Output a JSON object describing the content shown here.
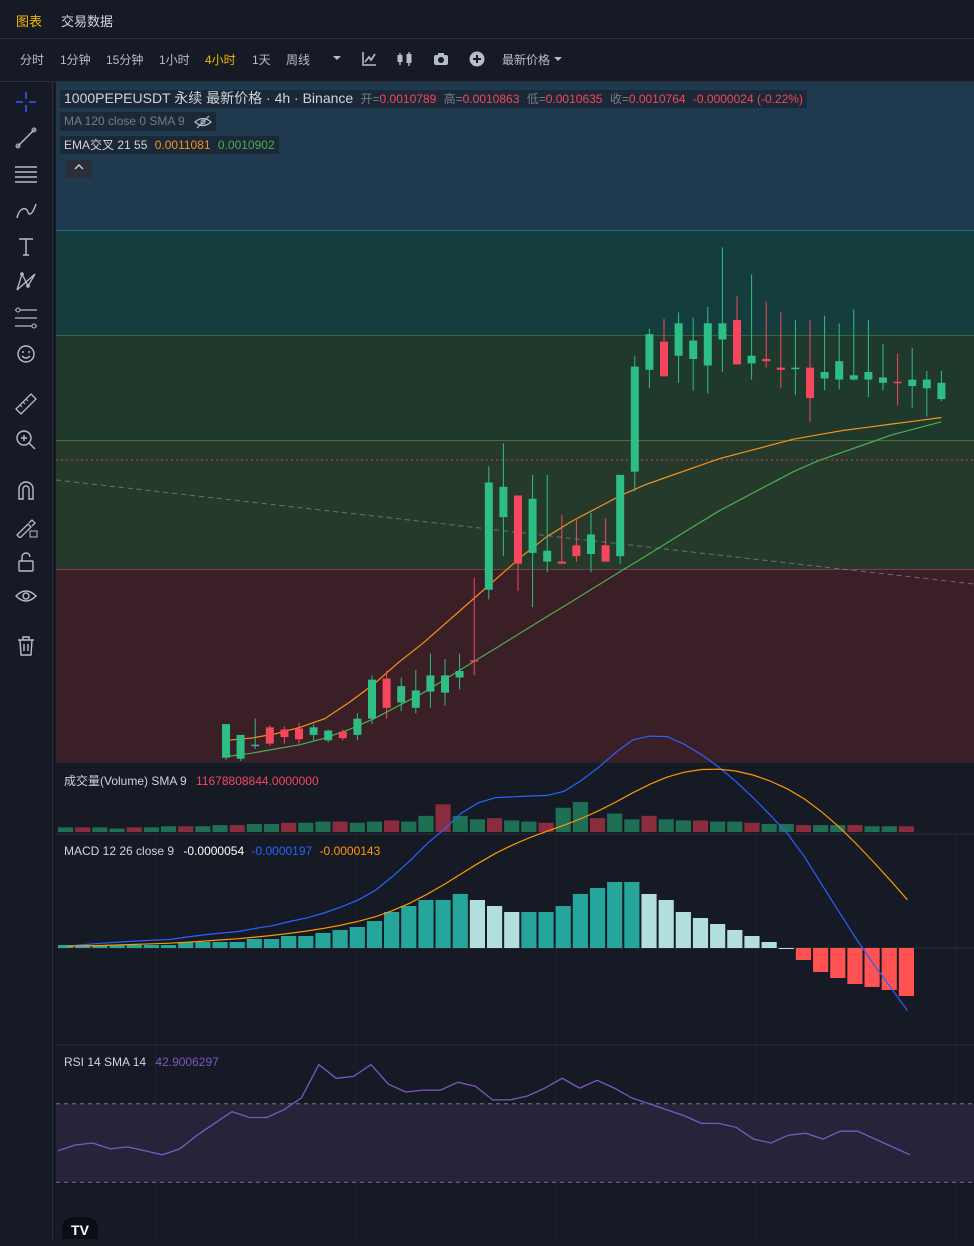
{
  "tabs": [
    {
      "label": "图表",
      "active": true
    },
    {
      "label": "交易数据",
      "active": false
    }
  ],
  "toolbar": {
    "intervals": [
      {
        "label": "分时"
      },
      {
        "label": "1分钟"
      },
      {
        "label": "15分钟"
      },
      {
        "label": "1小时"
      },
      {
        "label": "4小时",
        "active": true
      },
      {
        "label": "1天"
      },
      {
        "label": "周线"
      }
    ],
    "price_type": "最新价格",
    "icons": [
      "chevron-down-icon",
      "indicator-icon",
      "candle-type-icon",
      "camera-icon",
      "add-icon"
    ]
  },
  "sidebar_tools": [
    "crosshair-icon",
    "trend-line-icon",
    "horizontal-lines-icon",
    "brush-icon",
    "text-icon",
    "pattern-icon",
    "fib-icon",
    "emoji-icon",
    "ruler-icon",
    "zoom-icon",
    "magnet-icon",
    "lock-draw-icon",
    "unlock-icon",
    "eye-icon",
    "trash-icon"
  ],
  "legend": {
    "symbol": "1000PEPEUSDT 永续 最新价格 · 4h · Binance",
    "open_label": "开=",
    "open": "0.0010789",
    "high_label": "高=",
    "high": "0.0010863",
    "low_label": "低=",
    "low": "0.0010635",
    "close_label": "收=",
    "close": "0.0010764",
    "change": "-0.0000024 (-0.22%)",
    "ma_text": "MA 120 close 0 SMA 9",
    "ema_text": "EMA交叉 21 55",
    "ema21": "0.0011081",
    "ema55": "0.0010902"
  },
  "volume": {
    "label": "成交量(Volume) SMA 9",
    "value": "11678808844.0000000"
  },
  "macd": {
    "label": "MACD 12 26 close 9",
    "hist": "-0.0000054",
    "macd": "-0.0000197",
    "signal": "-0.0000143"
  },
  "rsi": {
    "label": "RSI 14 SMA 14",
    "value": "42.9006297"
  },
  "logo": "TV",
  "colors": {
    "up": "#2ebd85",
    "down": "#f6465d",
    "ema21": "#f7931a",
    "ema55": "#4caf50",
    "macd": "#2962ff",
    "signal": "#ff9800",
    "rsi": "#7e57c2",
    "accent": "#f0b90b"
  },
  "chart_data": [
    {
      "type": "candlestick",
      "title": "1000PEPEUSDT 永续 最新价格 4h",
      "zones": [
        {
          "color": "teal-blue"
        },
        {
          "color": "teal-green"
        },
        {
          "color": "green"
        },
        {
          "color": "dark-green"
        },
        {
          "color": "dark-red"
        }
      ],
      "candles": [
        [
          2,
          22,
          4,
          35
        ],
        [
          1,
          18,
          3,
          25
        ],
        [
          12,
          40,
          15,
          16
        ],
        [
          15,
          34,
          32,
          17
        ],
        [
          17,
          33,
          30,
          23
        ],
        [
          17,
          36,
          31,
          21
        ],
        [
          20,
          35,
          25,
          32
        ],
        [
          18,
          30,
          20,
          29
        ],
        [
          20,
          30,
          28,
          22
        ],
        [
          20,
          45,
          25,
          40
        ],
        [
          35,
          80,
          40,
          76
        ],
        [
          40,
          84,
          77,
          50
        ],
        [
          47,
          78,
          55,
          70
        ],
        [
          45,
          85,
          50,
          66
        ],
        [
          50,
          100,
          65,
          80
        ],
        [
          52,
          95,
          64,
          80
        ],
        [
          67,
          100,
          78,
          84
        ],
        [
          80,
          170,
          94,
          93
        ],
        [
          150,
          273,
          159,
          258
        ],
        [
          190,
          294,
          226,
          254
        ],
        [
          158,
          245,
          246,
          183
        ],
        [
          143,
          265,
          193,
          243
        ],
        [
          175,
          265,
          185,
          195
        ],
        [
          183,
          228,
          185,
          183
        ],
        [
          185,
          225,
          200,
          190
        ],
        [
          175,
          230,
          192,
          210
        ],
        [
          190,
          225,
          200,
          185
        ],
        [
          183,
          263,
          190,
          265
        ],
        [
          250,
          375,
          268,
          365
        ],
        [
          345,
          400,
          362,
          395
        ],
        [
          356,
          409,
          388,
          356
        ],
        [
          350,
          415,
          375,
          405
        ],
        [
          343,
          410,
          372,
          389
        ],
        [
          340,
          420,
          366,
          405
        ],
        [
          360,
          475,
          390,
          405
        ],
        [
          377,
          430,
          408,
          367
        ],
        [
          353,
          450,
          368,
          375
        ],
        [
          364,
          425,
          372,
          370
        ],
        [
          345,
          415,
          364,
          362
        ],
        [
          339,
          408,
          364,
          364
        ],
        [
          314,
          408,
          364,
          336
        ],
        [
          343,
          412,
          354,
          360
        ],
        [
          344,
          405,
          353,
          370
        ],
        [
          352,
          418,
          353,
          357
        ],
        [
          337,
          408,
          353,
          360
        ],
        [
          343,
          386,
          350,
          355
        ],
        [
          329,
          377,
          351,
          350
        ],
        [
          327,
          382,
          347,
          353
        ],
        [
          319,
          361,
          345,
          353
        ],
        [
          333,
          361,
          335,
          350
        ]
      ],
      "ema21": [
        20,
        22,
        26,
        32,
        40,
        55,
        72,
        92,
        110,
        130,
        150,
        170,
        190,
        208,
        222,
        234,
        246,
        256,
        264,
        272,
        280,
        286,
        292,
        298,
        302,
        306,
        309,
        312,
        315,
        318
      ],
      "ema55": [
        5,
        8,
        12,
        16,
        22,
        30,
        40,
        52,
        64,
        78,
        92,
        106,
        120,
        134,
        148,
        162,
        176,
        190,
        204,
        218,
        232,
        244,
        256,
        268,
        278,
        286,
        294,
        302,
        308,
        314
      ]
    },
    {
      "type": "bar",
      "title": "成交量(Volume)",
      "values": [
        4,
        4,
        4,
        3,
        4,
        4,
        5,
        5,
        5,
        6,
        6,
        7,
        7,
        8,
        8,
        9,
        9,
        8,
        9,
        10,
        9,
        14,
        24,
        14,
        11,
        12,
        10,
        9,
        8,
        21,
        26,
        12,
        16,
        11,
        14,
        11,
        10,
        10,
        9,
        9,
        8,
        7,
        7,
        6,
        6,
        6,
        6,
        5,
        5,
        5
      ]
    },
    {
      "type": "bar",
      "title": "MACD",
      "values": [
        1,
        1,
        1,
        1,
        1,
        1,
        1,
        2,
        2,
        2,
        2,
        3,
        3,
        4,
        4,
        5,
        6,
        7,
        9,
        12,
        14,
        16,
        16,
        18,
        16,
        14,
        12,
        12,
        12,
        14,
        18,
        20,
        22,
        22,
        18,
        16,
        12,
        10,
        8,
        6,
        4,
        2,
        0,
        -4,
        -8,
        -10,
        -12,
        -13,
        -14,
        -16
      ]
    },
    {
      "type": "line",
      "title": "RSI",
      "values": [
        46,
        49,
        50,
        47,
        48,
        46,
        44,
        47,
        54,
        60,
        66,
        63,
        63,
        67,
        73,
        90,
        83,
        84,
        90,
        80,
        76,
        77,
        77,
        81,
        79,
        72,
        72,
        74,
        78,
        83,
        78,
        82,
        78,
        73,
        70,
        67,
        64,
        60,
        60,
        58,
        52,
        50,
        54,
        55,
        52,
        56,
        56,
        52,
        48,
        44
      ]
    }
  ]
}
